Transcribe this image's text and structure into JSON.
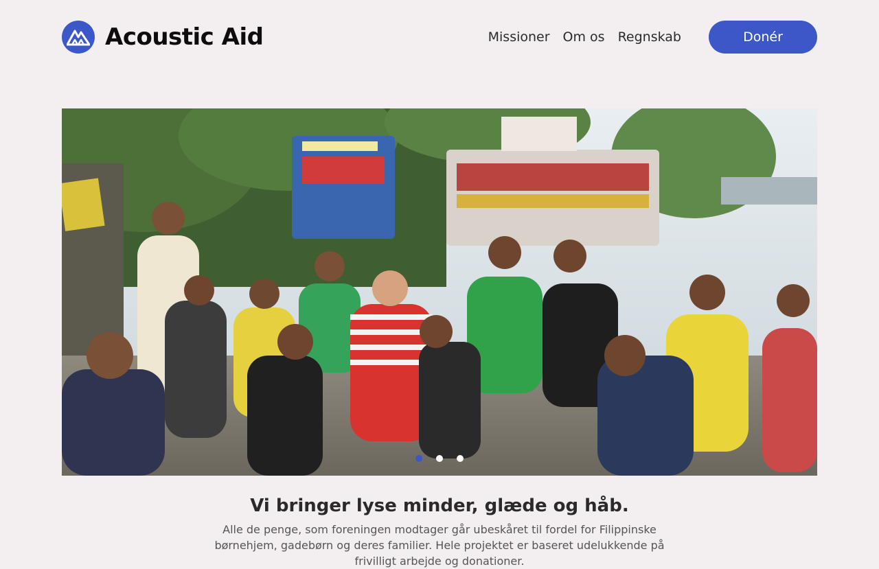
{
  "brand": {
    "name": "Acoustic Aid",
    "logo_icon": "mountain-logo-icon",
    "accent": "#3b57c8"
  },
  "nav": {
    "items": [
      "Missioner",
      "Om os",
      "Regnskab"
    ]
  },
  "donate": {
    "label": "Donér"
  },
  "hero": {
    "alt": "Gruppebillede med børn foran farverige jeepneys",
    "slides": 3,
    "active_slide": 1
  },
  "intro": {
    "heading": "Vi bringer lyse minder, glæde og håb.",
    "text": "Alle de penge, som foreningen modtager går ubeskåret til fordel for Filippinske børnehjem, gadebørn og deres familier. Hele projektet er baseret udelukkende på frivilligt arbejde og donationer."
  }
}
